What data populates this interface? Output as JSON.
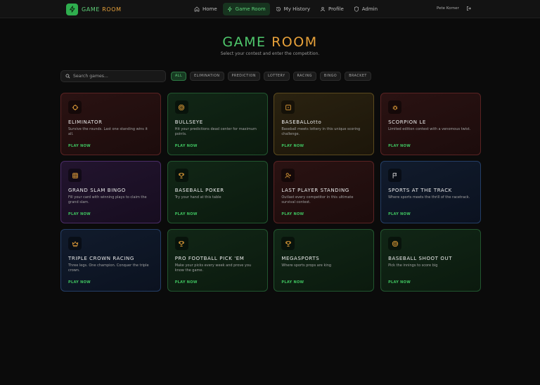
{
  "brand": {
    "part1": "GAME",
    "part2": "ROOM",
    "icon": "lightning-icon"
  },
  "nav": [
    {
      "label": "Home",
      "icon": "home-icon",
      "active": false
    },
    {
      "label": "Game Room",
      "icon": "lightning-icon",
      "active": true
    },
    {
      "label": "My History",
      "icon": "history-icon",
      "active": false
    },
    {
      "label": "Profile",
      "icon": "user-icon",
      "active": false
    },
    {
      "label": "Admin",
      "icon": "shield-icon",
      "active": false
    }
  ],
  "user": {
    "name": "Pete Korner"
  },
  "hero": {
    "title1": "GAME",
    "title2": "ROOM",
    "subtitle": "Select your contest and enter the competition."
  },
  "search": {
    "placeholder": "Search games...",
    "value": ""
  },
  "filters": [
    {
      "label": "ALL",
      "active": true
    },
    {
      "label": "ELIMINATION",
      "active": false
    },
    {
      "label": "PREDICTION",
      "active": false
    },
    {
      "label": "LOTTERY",
      "active": false
    },
    {
      "label": "RACING",
      "active": false
    },
    {
      "label": "BINGO",
      "active": false
    },
    {
      "label": "BRACKET",
      "active": false
    }
  ],
  "play_label": "PLAY NOW",
  "colors": {
    "accent_green": "#4fc86c",
    "accent_amber": "#e7a13a"
  },
  "games": [
    {
      "title": "ELIMINATOR",
      "desc": "Survive the rounds. Last one standing wins it all.",
      "theme": "red",
      "icon": "crosshair-icon",
      "icon_color": "#e7a13a"
    },
    {
      "title": "BULLSEYE",
      "desc": "Hit your predictions dead center for maximum points.",
      "theme": "green",
      "icon": "target-icon",
      "icon_color": "#e7a13a"
    },
    {
      "title": "BASEBALLotto",
      "desc": "Baseball meets lottery in this unique scoring challenge.",
      "theme": "amber",
      "icon": "ticket-icon",
      "icon_color": "#e7a13a"
    },
    {
      "title": "SCORPION LE",
      "desc": "Limited edition contest with a venomous twist.",
      "theme": "red",
      "icon": "bug-icon",
      "icon_color": "#e7a13a"
    },
    {
      "title": "GRAND SLAM BINGO",
      "desc": "Fill your card with winning plays to claim the grand slam.",
      "theme": "purple",
      "icon": "grid-icon",
      "icon_color": "#e7a13a"
    },
    {
      "title": "BASEBALL POKER",
      "desc": "Try your hand at this table",
      "theme": "green",
      "icon": "trophy-icon",
      "icon_color": "#e7a13a"
    },
    {
      "title": "LAST PLAYER STANDING",
      "desc": "Outlast every competitor in this ultimate survival contest.",
      "theme": "red",
      "icon": "user-plus-icon",
      "icon_color": "#e7a13a"
    },
    {
      "title": "SPORTS AT THE TRACK",
      "desc": "Where sports meets the thrill of the racetrack.",
      "theme": "blue",
      "icon": "flag-icon",
      "icon_color": "#e0e0e0"
    },
    {
      "title": "TRIPLE CROWN RACING",
      "desc": "Three legs. One champion. Conquer the triple crown.",
      "theme": "blue",
      "icon": "crown-icon",
      "icon_color": "#e7a13a"
    },
    {
      "title": "PRO FOOTBALL PICK 'EM",
      "desc": "Make your picks every week and prove you know the game.",
      "theme": "green",
      "icon": "trophy-icon",
      "icon_color": "#e7a13a"
    },
    {
      "title": "MEGASPORTS",
      "desc": "Where sports props are king",
      "theme": "green",
      "icon": "trophy-icon",
      "icon_color": "#e7a13a"
    },
    {
      "title": "BASEBALL SHOOT OUT",
      "desc": "Pick the innings to score big",
      "theme": "green",
      "icon": "target-icon",
      "icon_color": "#e7a13a"
    }
  ]
}
